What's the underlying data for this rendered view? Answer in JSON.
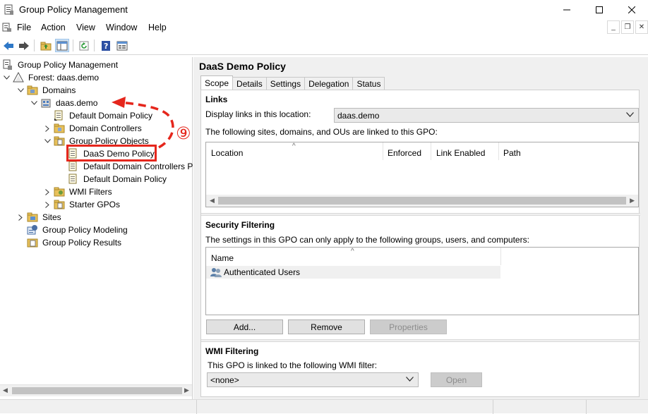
{
  "window": {
    "title": "Group Policy Management"
  },
  "menu": {
    "items": [
      "File",
      "Action",
      "View",
      "Window",
      "Help"
    ]
  },
  "toolbar": {
    "icons": [
      "back-arrow-icon",
      "forward-arrow-icon",
      "folder-up-icon",
      "show-hide-tree-icon",
      "refresh-icon",
      "help-icon",
      "properties-icon"
    ]
  },
  "tree": {
    "root": "Group Policy Management",
    "forest": "Forest: daas.demo",
    "domains": "Domains",
    "domain": "daas.demo",
    "default_domain_policy": "Default Domain Policy",
    "domain_controllers": "Domain Controllers",
    "gpo_container": "Group Policy Objects",
    "gpo_daas": "DaaS Demo Policy",
    "gpo_ddcp": "Default Domain Controllers P",
    "gpo_ddp": "Default Domain Policy",
    "wmi_filters": "WMI Filters",
    "starter_gpos": "Starter GPOs",
    "sites": "Sites",
    "modeling": "Group Policy Modeling",
    "results": "Group Policy Results"
  },
  "annotation": {
    "step": "⑨",
    "color": "#e5261c"
  },
  "detail": {
    "title": "DaaS Demo Policy",
    "tabs": [
      "Scope",
      "Details",
      "Settings",
      "Delegation",
      "Status"
    ],
    "links": {
      "heading": "Links",
      "display_label": "Display links in this location:",
      "location_value": "daas.demo",
      "linked_text": "The following sites, domains, and OUs are linked to this GPO:",
      "columns": [
        "Location",
        "Enforced",
        "Link Enabled",
        "Path"
      ]
    },
    "security": {
      "heading": "Security Filtering",
      "description": "The settings in this GPO can only apply to the following groups, users, and computers:",
      "column": "Name",
      "rows": [
        "Authenticated Users"
      ],
      "add": "Add...",
      "remove": "Remove",
      "properties": "Properties"
    },
    "wmi": {
      "heading": "WMI Filtering",
      "description": "This GPO is linked to the following WMI filter:",
      "filter_value": "<none>",
      "open": "Open"
    }
  }
}
